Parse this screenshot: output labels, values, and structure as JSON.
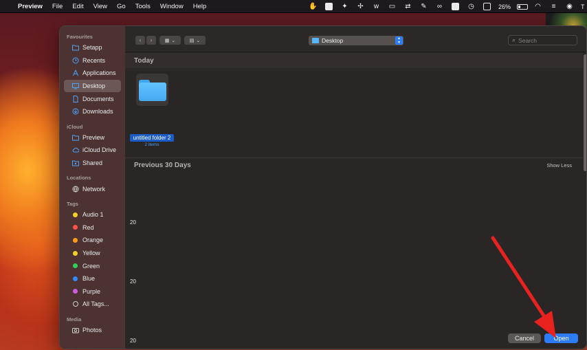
{
  "menubar": {
    "app_name": "Preview",
    "menus": [
      "File",
      "Edit",
      "View",
      "Go",
      "Tools",
      "Window",
      "Help"
    ],
    "battery": "26%",
    "clock_partial": "T"
  },
  "dialog": {
    "sidebar": {
      "favourites_title": "Favourites",
      "favourites": [
        "Setapp",
        "Recents",
        "Applications",
        "Desktop",
        "Documents",
        "Downloads"
      ],
      "selected": "Desktop",
      "icloud_title": "iCloud",
      "icloud": [
        "Preview",
        "iCloud Drive",
        "Shared"
      ],
      "locations_title": "Locations",
      "locations": [
        "Network"
      ],
      "tags_title": "Tags",
      "tags": [
        {
          "label": "Audio 1",
          "color": "#f5d02a"
        },
        {
          "label": "Red",
          "color": "#ff4f48"
        },
        {
          "label": "Orange",
          "color": "#ff9a1a"
        },
        {
          "label": "Yellow",
          "color": "#f5d02a"
        },
        {
          "label": "Green",
          "color": "#30d158"
        },
        {
          "label": "Blue",
          "color": "#2f8cff"
        },
        {
          "label": "Purple",
          "color": "#d05ce3"
        }
      ],
      "all_tags": "All Tags...",
      "media_title": "Media",
      "media": [
        "Photos"
      ]
    },
    "toolbar": {
      "back": "‹",
      "forward": "›",
      "location": "Desktop",
      "search_placeholder": "Search"
    },
    "groups": {
      "today": "Today",
      "previous": "Previous 30 Days",
      "show_less": "Show Less"
    },
    "folder": {
      "name": "untitled folder 2",
      "count": "2 items"
    },
    "row_labels": [
      "20",
      "20",
      "20"
    ],
    "buttons": {
      "cancel": "Cancel",
      "open": "Open"
    }
  },
  "accent_color": "#2d7cf6",
  "annotation_arrow_color": "#e8231f"
}
